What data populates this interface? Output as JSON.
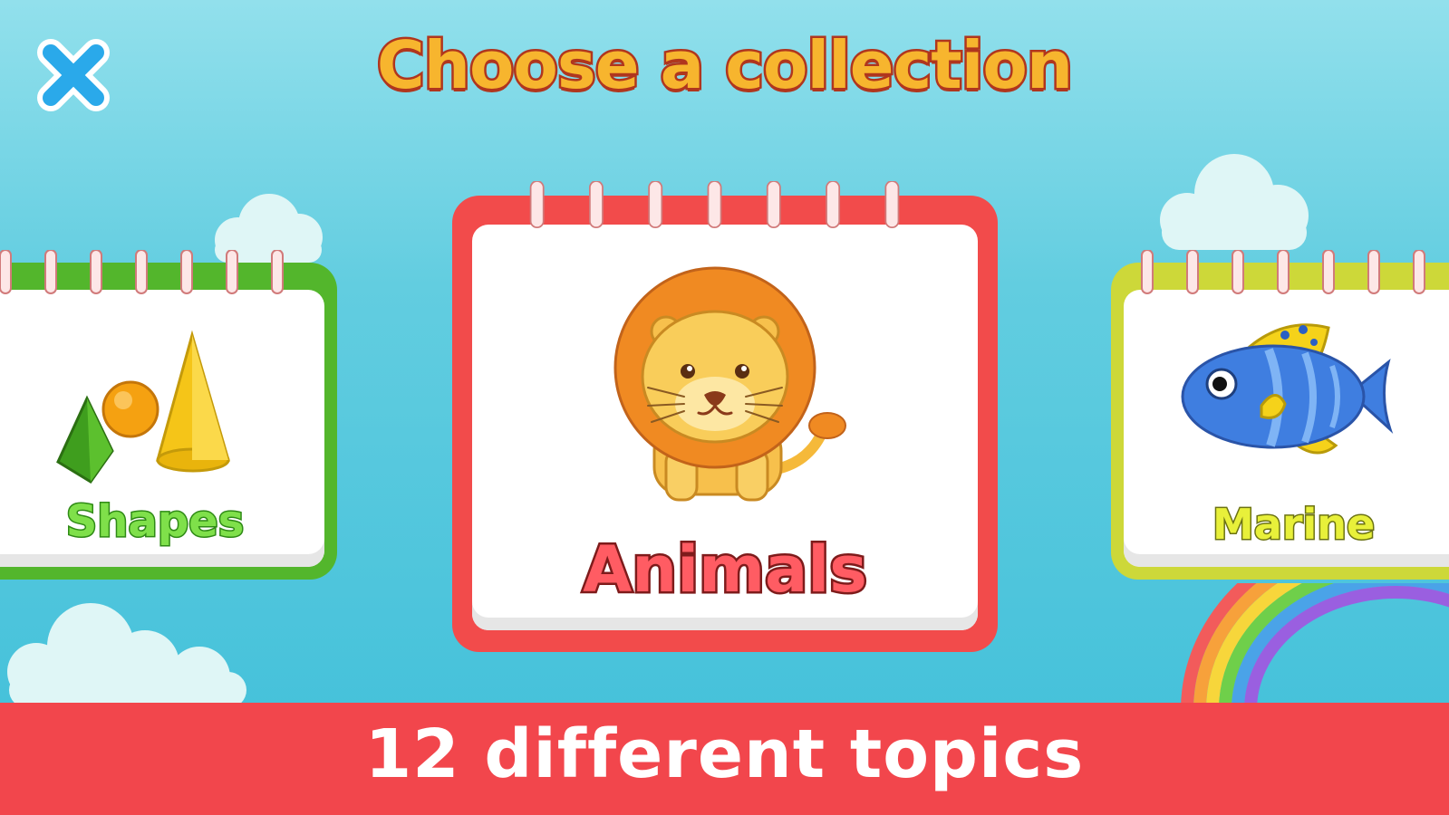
{
  "title": "Choose a collection",
  "close_button": {
    "icon": "close-icon"
  },
  "collections": [
    {
      "label": "Shapes",
      "icon": "shapes-icon",
      "color": "#53b62c"
    },
    {
      "label": "Animals",
      "icon": "lion-icon",
      "color": "#f24b4b"
    },
    {
      "label": "Marine",
      "icon": "fish-icon",
      "color": "#cdd839"
    }
  ],
  "banner": {
    "text": "12 different topics"
  },
  "colors": {
    "sky_top": "#92e0ec",
    "sky_bottom": "#3fbfd9",
    "title_fill": "#f7b52e",
    "title_outline": "#b0361e",
    "banner": "#f2464c"
  }
}
